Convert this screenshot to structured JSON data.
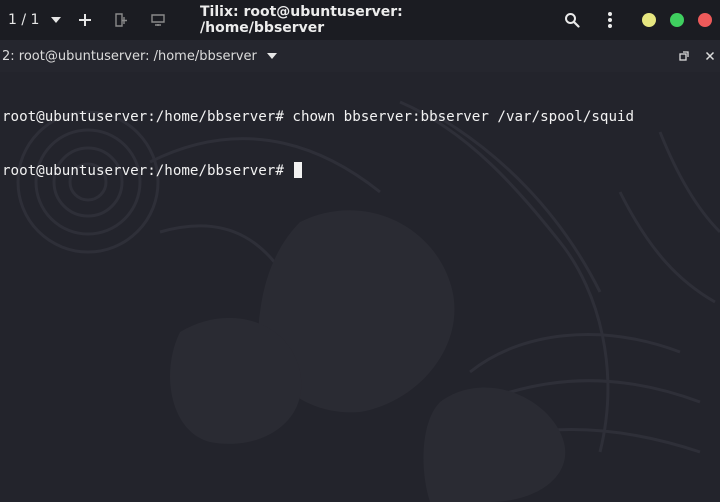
{
  "titlebar": {
    "session_counter": "1 / 1",
    "title": "Tilix: root@ubuntuserver: /home/bbserver",
    "icons": [
      "add-icon",
      "split-right-icon",
      "split-down-icon",
      "search-icon",
      "menu-icon"
    ],
    "window_buttons": {
      "minimize_color": "#e6e680",
      "maximize_color": "#3fcf5f",
      "close_color": "#ee5a5a"
    }
  },
  "pane": {
    "title": "2: root@ubuntuserver: /home/bbserver",
    "controls": [
      "maximize-pane-icon",
      "close-pane-icon"
    ]
  },
  "terminal": {
    "lines": [
      "root@ubuntuserver:/home/bbserver# chown bbserver:bbserver /var/spool/squid",
      "root@ubuntuserver:/home/bbserver# "
    ]
  },
  "colors": {
    "titlebar_bg": "#1b1c22",
    "terminal_bg": "#23242c",
    "text": "#f2f2f2"
  }
}
